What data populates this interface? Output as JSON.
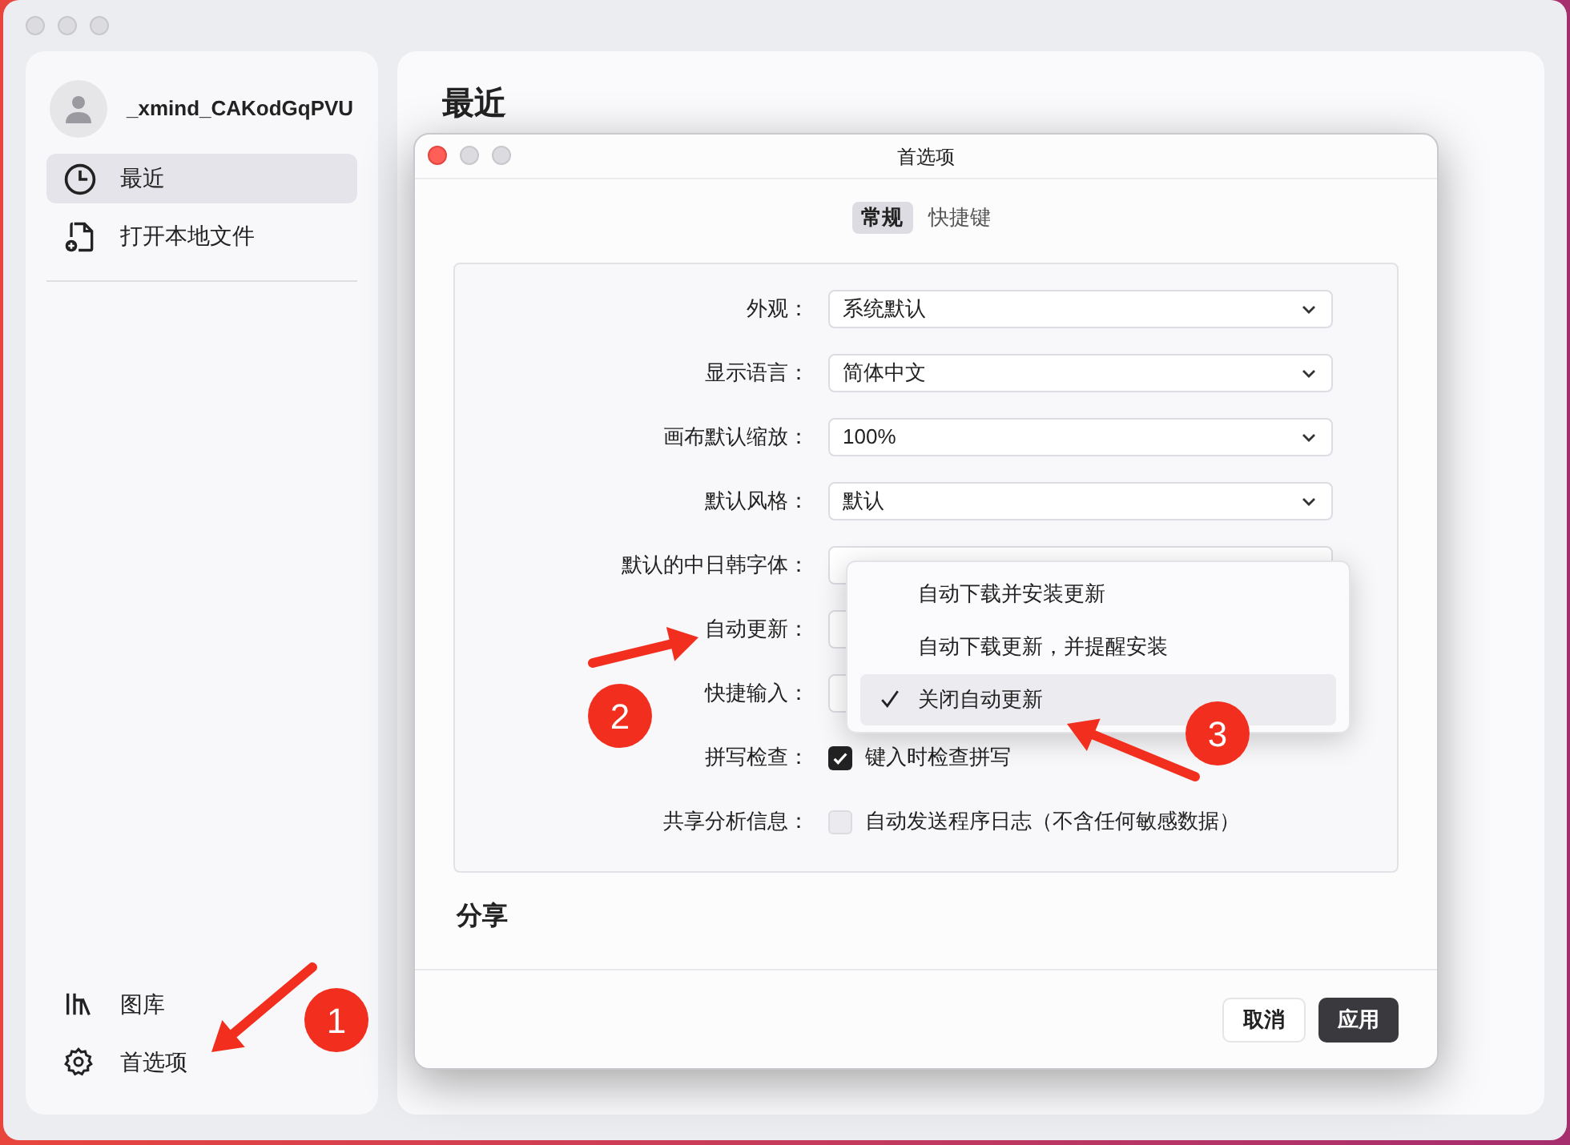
{
  "sidebar": {
    "user": {
      "name": "_xmind_CAKodGqPVU"
    },
    "nav": [
      {
        "label": "最近",
        "selected": true
      },
      {
        "label": "打开本地文件",
        "selected": false
      }
    ],
    "bottom": [
      {
        "label": "图库"
      },
      {
        "label": "首选项"
      }
    ]
  },
  "main": {
    "title": "最近"
  },
  "dialog": {
    "title": "首选项",
    "tabs": [
      {
        "label": "常规",
        "selected": true
      },
      {
        "label": "快捷键",
        "selected": false
      }
    ],
    "settings": [
      {
        "kind": "select",
        "label": "外观：",
        "value": "系统默认"
      },
      {
        "kind": "select",
        "label": "显示语言：",
        "value": "简体中文"
      },
      {
        "kind": "select",
        "label": "画布默认缩放：",
        "value": "100%"
      },
      {
        "kind": "select",
        "label": "默认风格：",
        "value": "默认"
      },
      {
        "kind": "select",
        "label": "默认的中日韩字体："
      },
      {
        "kind": "select",
        "label": "自动更新："
      },
      {
        "kind": "select",
        "label": "快捷输入："
      },
      {
        "kind": "checkbox",
        "label": "拼写检查：",
        "text": "键入时检查拼写",
        "checked": true
      },
      {
        "kind": "checkbox",
        "label": "共享分析信息：",
        "text": "自动发送程序日志（不含任何敏感数据）",
        "checked": false
      }
    ],
    "menu": {
      "items": [
        {
          "label": "自动下载并安装更新",
          "selected": false
        },
        {
          "label": "自动下载更新，并提醒安装",
          "selected": false
        },
        {
          "label": "关闭自动更新",
          "selected": true
        }
      ]
    },
    "section": "分享",
    "buttons": [
      {
        "label": "取消",
        "kind": "secondary"
      },
      {
        "label": "应用",
        "kind": "primary"
      }
    ]
  },
  "annotations": [
    {
      "label": "1"
    },
    {
      "label": "2"
    },
    {
      "label": "3"
    }
  ]
}
